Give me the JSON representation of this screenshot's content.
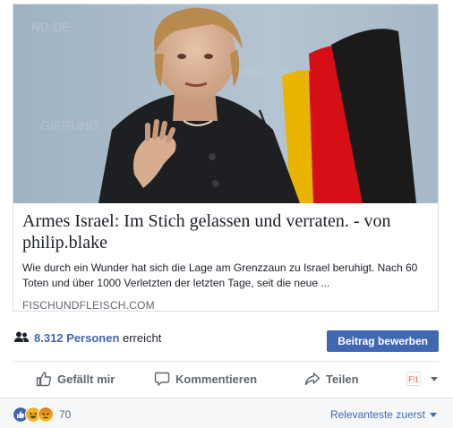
{
  "link_card": {
    "title": "Armes Israel: Im Stich gelassen und verraten. - von philip.blake",
    "description": "Wie durch ein Wunder hat sich die Lage am Grenzzaun zu Israel beruhigt. Nach 60 Toten und über 1000 Verletzten der letzten Tage, seit die neue ...",
    "source": "FISCHUNDFLEISCH.COM"
  },
  "reach": {
    "count_label": "8.312 Personen",
    "suffix": " erreicht",
    "promote_label": "Beitrag bewerben"
  },
  "actions": {
    "like": "Gefällt mir",
    "comment": "Kommentieren",
    "share": "Teilen"
  },
  "reactions": {
    "count": "70",
    "types": [
      "like-icon",
      "haha-icon",
      "angry-icon"
    ]
  },
  "sort": {
    "label": "Relevanteste zuerst"
  },
  "colors": {
    "brand_blue": "#4267b2",
    "muted_text": "#606770",
    "border": "#dddfe2"
  }
}
